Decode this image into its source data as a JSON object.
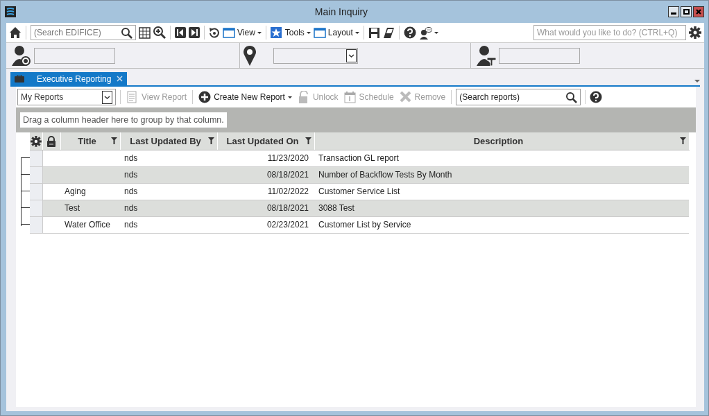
{
  "window": {
    "title": "Main Inquiry"
  },
  "toolbar": {
    "search": {
      "placeholder": "(Search EDIFICE)"
    },
    "menus": [
      {
        "label": "View",
        "kind": "window"
      },
      {
        "label": "Tools",
        "kind": "star"
      },
      {
        "label": "Layout",
        "kind": "window"
      }
    ],
    "command": {
      "placeholder": "What would you like to do? (CTRL+Q)"
    }
  },
  "context_fields": [
    {
      "kind": "person"
    },
    {
      "kind": "location"
    },
    {
      "kind": "tenant"
    }
  ],
  "tabs": [
    {
      "label": "Executive Reporting",
      "selected": true
    }
  ],
  "report_toolbar": {
    "view_select": "My Reports",
    "actions": [
      {
        "label": "View Report",
        "kind": "report",
        "disabled": true
      },
      {
        "label": "Create New Report",
        "kind": "add",
        "disabled": false
      },
      {
        "label": "Unlock",
        "kind": "lock",
        "disabled": true
      },
      {
        "label": "Schedule",
        "kind": "calendar",
        "disabled": true
      },
      {
        "label": "Remove",
        "kind": "remove",
        "disabled": true
      }
    ],
    "search": {
      "placeholder": "(Search reports)"
    }
  },
  "group_panel": "Drag a column header here to group by that column.",
  "table": {
    "columns": [
      "Title",
      "Last Updated By",
      "Last Updated On",
      "Description"
    ],
    "rows": [
      [
        "",
        "nds",
        "11/23/2020",
        "Transaction GL report"
      ],
      [
        "",
        "nds",
        "08/18/2021",
        "Number of Backflow Tests By Month"
      ],
      [
        "Aging",
        "nds",
        "11/02/2022",
        "Customer Service List"
      ],
      [
        "Test",
        "nds",
        "08/18/2021",
        "3088 Test"
      ],
      [
        "Water Office",
        "nds",
        "02/23/2021",
        "Customer List by Service"
      ]
    ]
  }
}
